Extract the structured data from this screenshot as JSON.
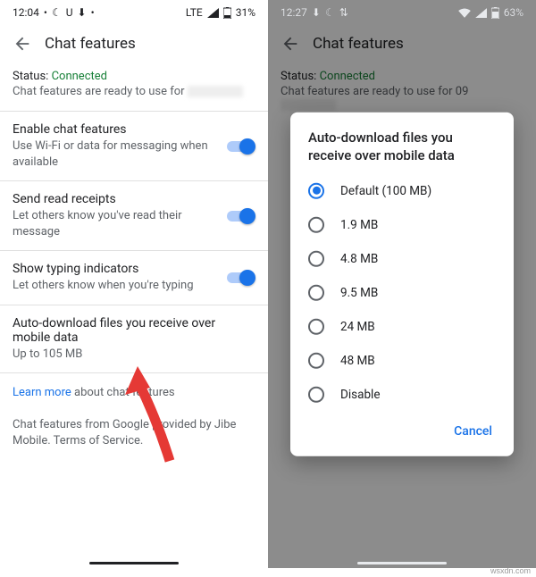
{
  "left": {
    "statusbar": {
      "time": "12:04",
      "network": "LTE",
      "battery": "31%"
    },
    "header": {
      "title": "Chat features"
    },
    "status": {
      "label": "Status:",
      "value": "Connected",
      "desc": "Chat features are ready to use for"
    },
    "rows": {
      "enable": {
        "title": "Enable chat features",
        "sub": "Use Wi-Fi or data for messaging when available"
      },
      "receipts": {
        "title": "Send read receipts",
        "sub": "Let others know you've read their message"
      },
      "typing": {
        "title": "Show typing indicators",
        "sub": "Let others know when you're typing"
      },
      "autodl": {
        "title": "Auto-download files you receive over mobile data",
        "sub": "Up to 105 MB"
      }
    },
    "learnmore": {
      "link": "Learn more",
      "rest": " about chat features"
    },
    "footer": "Chat features from Google provided by Jibe Mobile. Terms of Service."
  },
  "right": {
    "statusbar": {
      "time": "12:27",
      "battery": "63%"
    },
    "header": {
      "title": "Chat features"
    },
    "status": {
      "label": "Status:",
      "value": "Connected",
      "desc": "Chat features are ready to use for 09"
    },
    "dialog": {
      "title": "Auto-download files you receive over mobile data",
      "options": [
        "Default (100 MB)",
        "1.9 MB",
        "4.8 MB",
        "9.5 MB",
        "24 MB",
        "48 MB",
        "Disable"
      ],
      "selected": 0,
      "cancel": "Cancel"
    }
  },
  "watermark": "wsxdn.com"
}
